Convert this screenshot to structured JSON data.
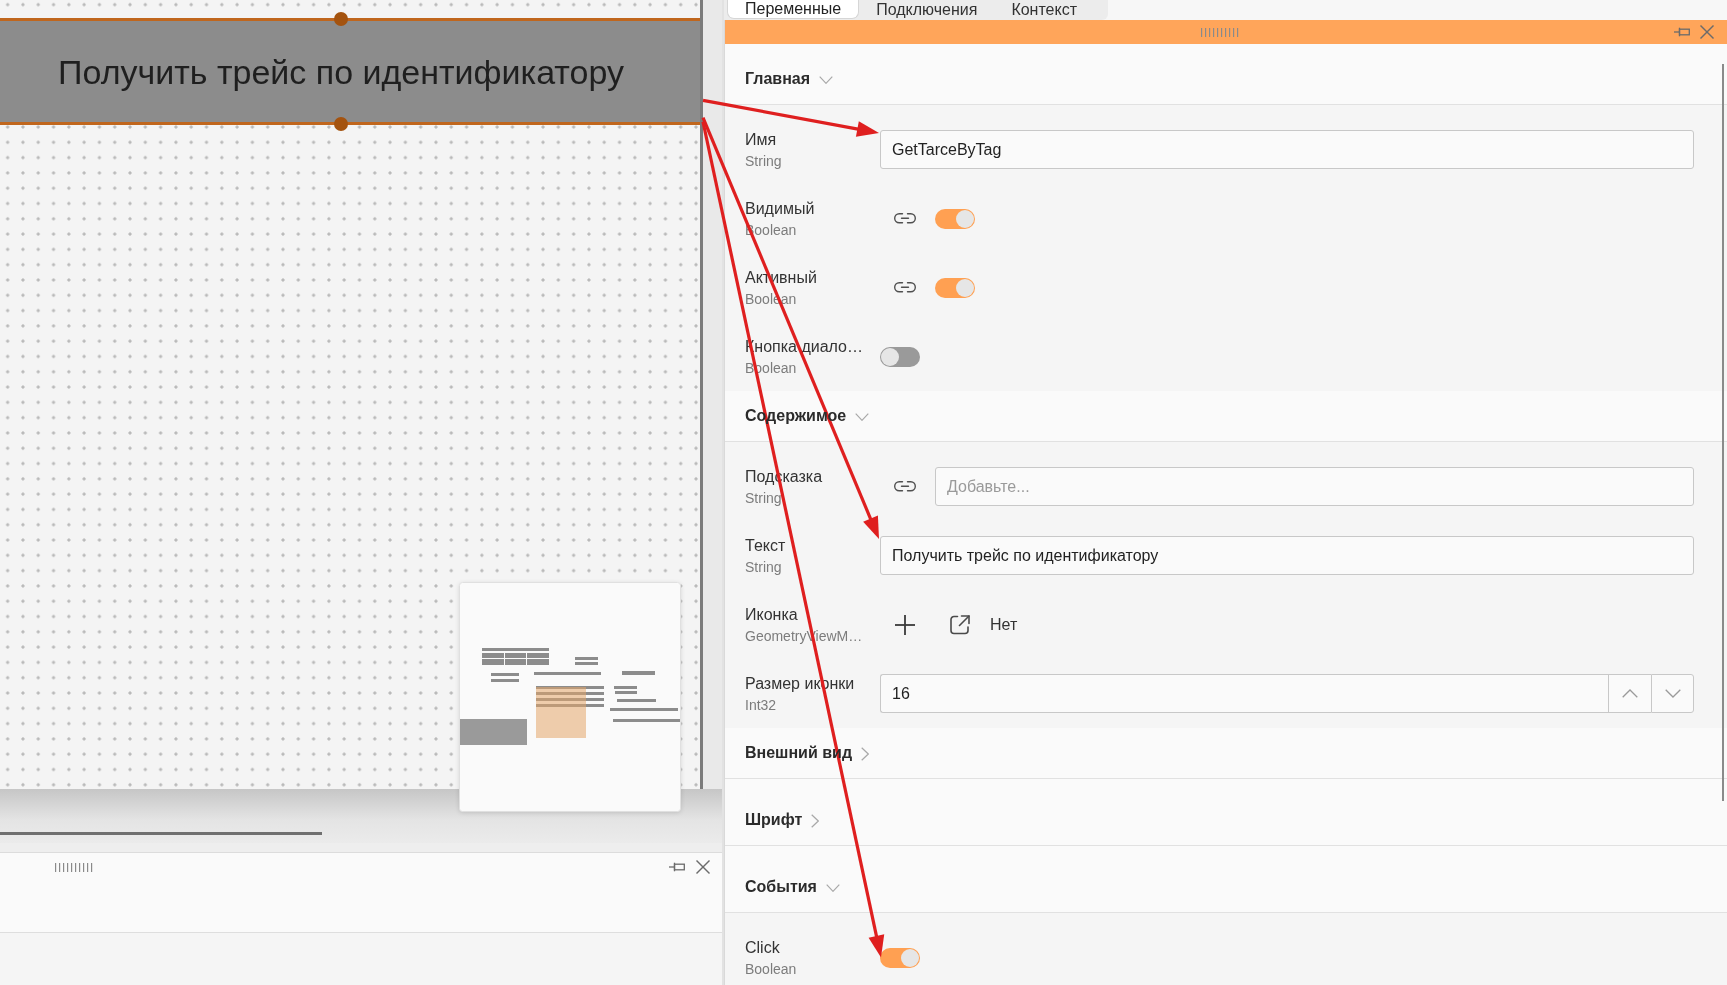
{
  "canvas": {
    "node": {
      "text": "Получить трейс по идентификатору",
      "selected": true
    }
  },
  "properties_panel": {
    "tabs": [
      {
        "label": "Переменные",
        "selected": true
      },
      {
        "label": "Подключения",
        "selected": false
      },
      {
        "label": "Контекст",
        "selected": false
      }
    ],
    "sections": [
      {
        "title": "Главная",
        "expanded": true,
        "rows": [
          {
            "kind": "text",
            "label": "Имя",
            "type": "String",
            "linked": false,
            "value": "GetTarceByTag",
            "annotated": true
          },
          {
            "kind": "toggle",
            "label": "Видимый",
            "type": "Boolean",
            "linked": true,
            "on": true,
            "annotated": false
          },
          {
            "kind": "toggle",
            "label": "Активный",
            "type": "Boolean",
            "linked": true,
            "on": true,
            "annotated": false
          },
          {
            "kind": "toggle",
            "label": "Кнопка диало…",
            "type": "Boolean",
            "linked": false,
            "on": false,
            "annotated": false
          }
        ]
      },
      {
        "title": "Содержимое",
        "expanded": true,
        "rows": [
          {
            "kind": "text",
            "label": "Подсказка",
            "type": "String",
            "linked": true,
            "placeholder": "Добавьте...",
            "annotated": false
          },
          {
            "kind": "text",
            "label": "Текст",
            "type": "String",
            "linked": false,
            "value": "Получить трейс по идентификатору",
            "annotated": true
          },
          {
            "kind": "icon",
            "label": "Иконка",
            "type": "GeometryViewM…",
            "linked": false,
            "value": "Нет",
            "annotated": false
          },
          {
            "kind": "number",
            "label": "Размер иконки",
            "type": "Int32",
            "linked": false,
            "value": "16",
            "annotated": false
          }
        ]
      },
      {
        "title": "Внешний вид",
        "expanded": false
      },
      {
        "title": "Шрифт",
        "expanded": false
      },
      {
        "title": "События",
        "expanded": true,
        "rows": [
          {
            "kind": "toggle",
            "label": "Click",
            "type": "Boolean",
            "linked": false,
            "on": true,
            "annotated": true
          }
        ]
      }
    ]
  }
}
